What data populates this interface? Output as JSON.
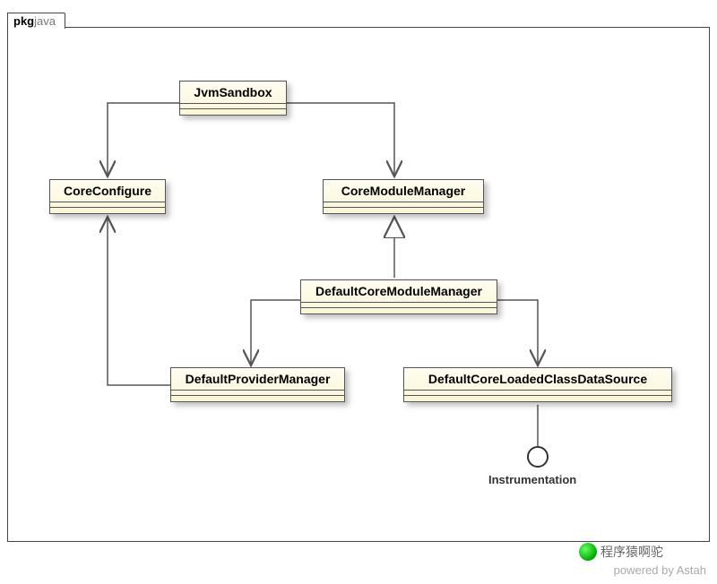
{
  "package": {
    "prefix": "pkg",
    "name": "java"
  },
  "classes": {
    "jvmSandbox": "JvmSandbox",
    "coreConfigure": "CoreConfigure",
    "coreModuleManager": "CoreModuleManager",
    "defaultCoreModuleManager": "DefaultCoreModuleManager",
    "defaultProviderManager": "DefaultProviderManager",
    "defaultCoreLoadedClassDataSource": "DefaultCoreLoadedClassDataSource"
  },
  "interface": {
    "instrumentation": "Instrumentation"
  },
  "relations": [
    {
      "from": "JvmSandbox",
      "to": "CoreConfigure",
      "type": "association"
    },
    {
      "from": "JvmSandbox",
      "to": "CoreModuleManager",
      "type": "association"
    },
    {
      "from": "DefaultCoreModuleManager",
      "to": "CoreModuleManager",
      "type": "realization"
    },
    {
      "from": "DefaultCoreModuleManager",
      "to": "DefaultProviderManager",
      "type": "association"
    },
    {
      "from": "DefaultCoreModuleManager",
      "to": "DefaultCoreLoadedClassDataSource",
      "type": "association"
    },
    {
      "from": "DefaultProviderManager",
      "to": "CoreConfigure",
      "type": "association"
    },
    {
      "from": "DefaultCoreLoadedClassDataSource",
      "to": "Instrumentation",
      "type": "interface"
    }
  ],
  "footer": {
    "poweredBy": "powered by Astah"
  },
  "watermark": {
    "text": "程序猿啊驼"
  }
}
